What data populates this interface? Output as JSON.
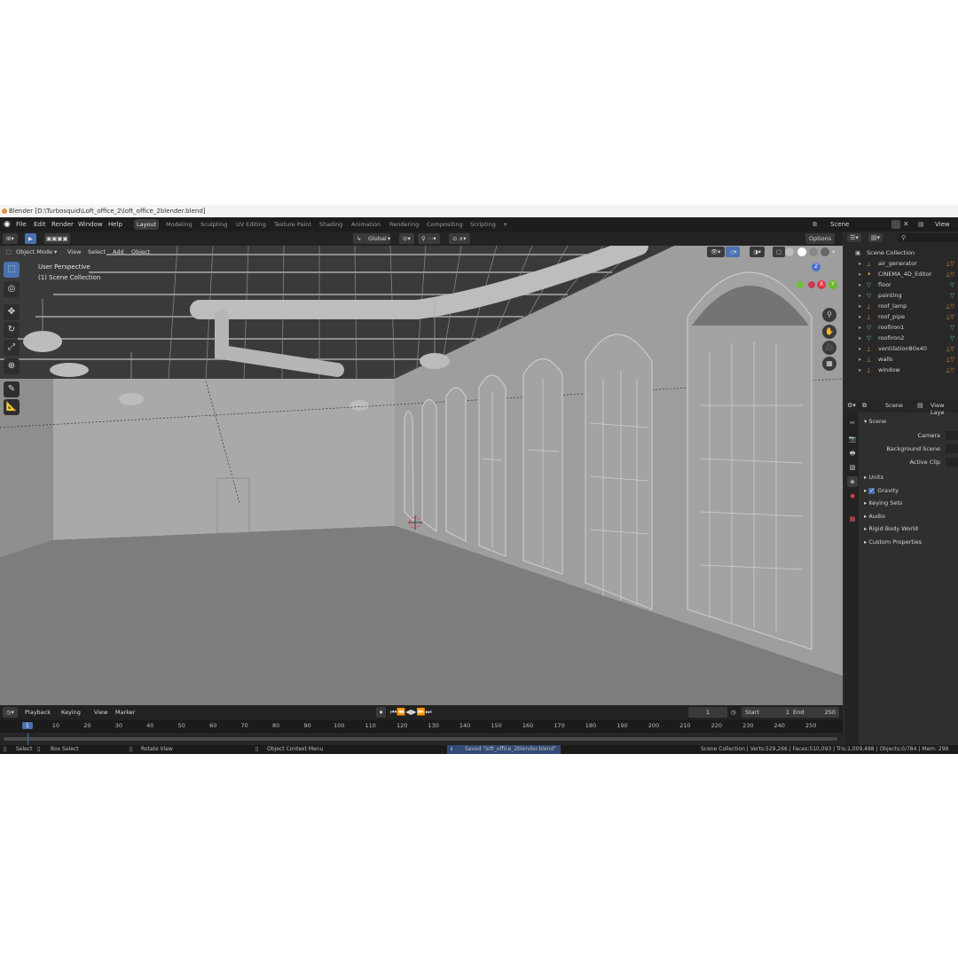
{
  "window_title": "Blender [D:\\Turbosquid\\Loft_office_2\\loft_office_2blender.blend]",
  "menu": [
    "File",
    "Edit",
    "Render",
    "Window",
    "Help"
  ],
  "workspace_tabs": [
    "Layout",
    "Modeling",
    "Sculpting",
    "UV Editing",
    "Texture Paint",
    "Shading",
    "Animation",
    "Rendering",
    "Compositing",
    "Scripting"
  ],
  "active_workspace": "Layout",
  "scene_selector": {
    "label": "Scene",
    "view_layer": "View Lay"
  },
  "header": {
    "transform_orientation": "Global",
    "options_label": "Options",
    "mode": "Object Mode",
    "menus": [
      "View",
      "Select",
      "Add",
      "Object"
    ]
  },
  "viewport": {
    "view_name": "User Perspective",
    "collection_info": "(1) Scene Collection",
    "gizmo_axes": [
      "Z",
      "X",
      "Y"
    ]
  },
  "outliner": {
    "root": "Scene Collection",
    "items": [
      {
        "name": "air_generator",
        "type": "armature"
      },
      {
        "name": "CINEMA_4D_Editor",
        "type": "camera"
      },
      {
        "name": "floor",
        "type": "mesh"
      },
      {
        "name": "painting",
        "type": "mesh"
      },
      {
        "name": "roof_lamp",
        "type": "armature"
      },
      {
        "name": "roof_pipe",
        "type": "armature"
      },
      {
        "name": "roofiron1",
        "type": "mesh"
      },
      {
        "name": "roofiron2",
        "type": "mesh"
      },
      {
        "name": "ventilation80x40",
        "type": "armature"
      },
      {
        "name": "walls",
        "type": "armature"
      },
      {
        "name": "window",
        "type": "armature"
      }
    ]
  },
  "properties": {
    "header_scene": "Scene",
    "header_view_layer": "View Laye",
    "section": "Scene",
    "fields": [
      {
        "label": "Camera"
      },
      {
        "label": "Background Scene"
      },
      {
        "label": "Active Clip"
      }
    ],
    "panels": [
      {
        "label": "Units",
        "checkbox": null
      },
      {
        "label": "Gravity",
        "checkbox": true
      },
      {
        "label": "Keying Sets",
        "checkbox": null
      },
      {
        "label": "Audio",
        "checkbox": null
      },
      {
        "label": "Rigid Body World",
        "checkbox": null
      },
      {
        "label": "Custom Properties",
        "checkbox": null
      }
    ]
  },
  "timeline": {
    "menus": [
      "Playback",
      "Keying",
      "View",
      "Marker"
    ],
    "current_frame": "1",
    "start_label": "Start",
    "start": "1",
    "end_label": "End",
    "end": "250",
    "ruler": [
      "1",
      "10",
      "20",
      "30",
      "40",
      "50",
      "60",
      "70",
      "80",
      "90",
      "100",
      "110",
      "120",
      "130",
      "140",
      "150",
      "160",
      "170",
      "180",
      "190",
      "200",
      "210",
      "220",
      "230",
      "240",
      "250"
    ],
    "playhead_label": "1"
  },
  "statusbar": {
    "select": "Select",
    "box_select": "Box Select",
    "rotate_view": "Rotate View",
    "context_menu": "Object Context Menu",
    "message": "Saved \"loft_office_2blender.blend\"",
    "stats": "Scene Collection | Verts:529,266 | Faces:510,093 | Tris:1,009,488 | Objects:0/784 | Mem: 299"
  },
  "colors": {
    "accent": "#4a71b0",
    "mesh_icon": "#5fcf8c",
    "object_icon": "#e5903a",
    "playhead": "#4a71b0"
  }
}
